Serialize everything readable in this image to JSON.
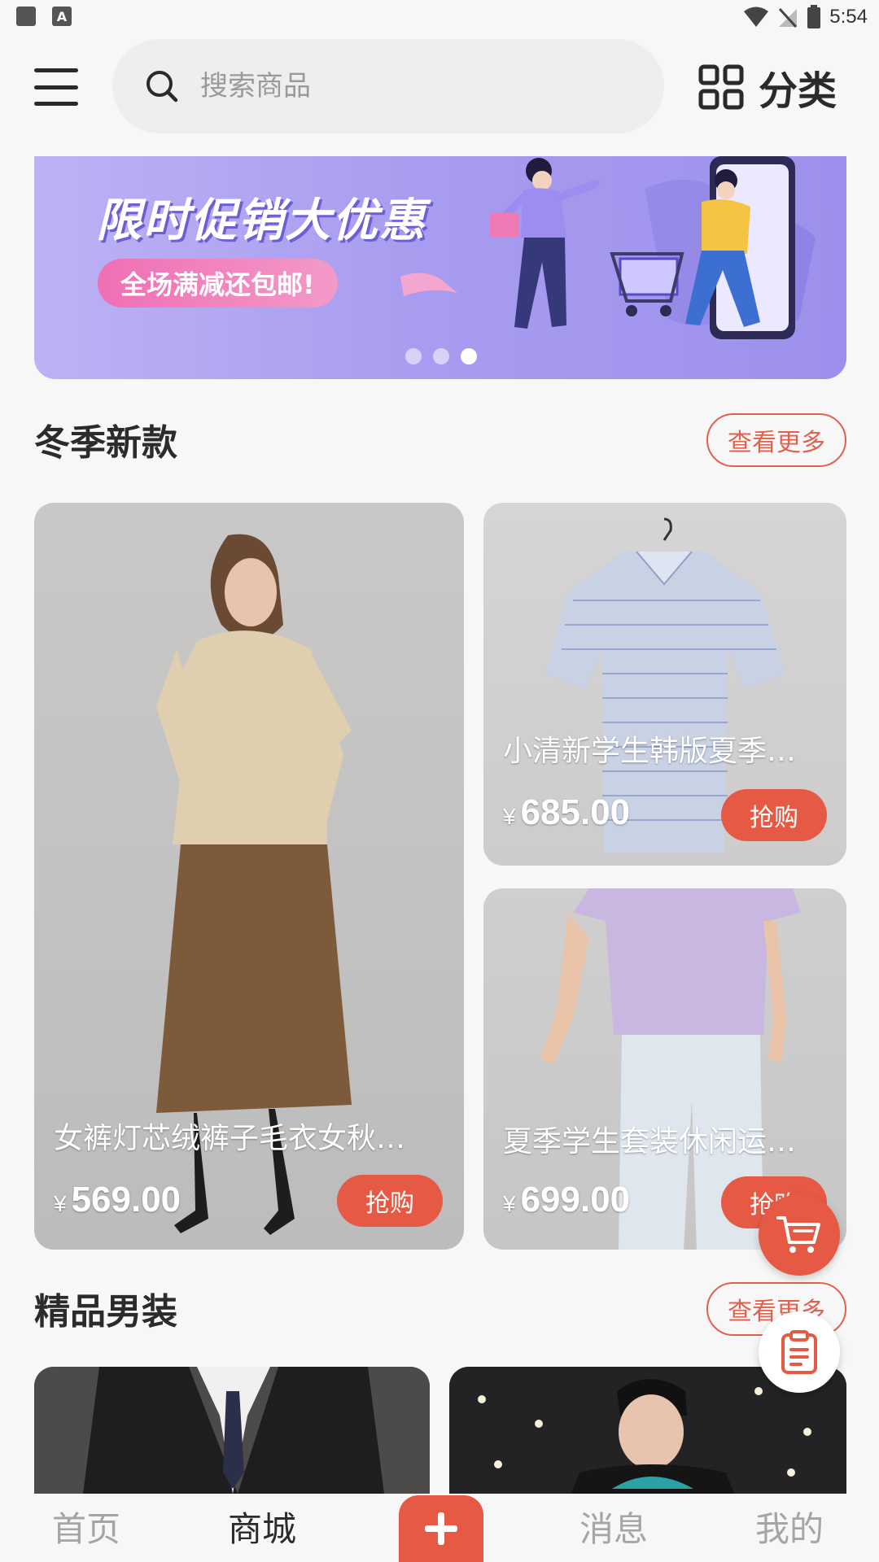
{
  "status_bar": {
    "time": "5:54",
    "left_icons": [
      "image-icon",
      "font-a-icon"
    ],
    "right_icons": [
      "wifi-icon",
      "no-signal-icon",
      "battery-icon"
    ]
  },
  "header": {
    "menu_icon": "menu-icon",
    "search_placeholder": "搜索商品",
    "category_label": "分类"
  },
  "banner": {
    "title": "限时促销大优惠",
    "subtitle": "全场满减还包邮!",
    "active_slide": 3,
    "slide_count": 3
  },
  "sections": [
    {
      "title": "冬季新款",
      "more_label": "查看更多",
      "products": [
        {
          "name": "女裤灯芯绒裤子毛衣女秋…",
          "currency": "¥",
          "price": "569.00",
          "buy_label": "抢购"
        },
        {
          "name": "小清新学生韩版夏季…",
          "currency": "¥",
          "price": "685.00",
          "buy_label": "抢购"
        },
        {
          "name": "夏季学生套装休闲运…",
          "currency": "¥",
          "price": "699.00",
          "buy_label": "抢购"
        }
      ]
    },
    {
      "title": "精品男装",
      "more_label": "查看更多"
    }
  ],
  "floating": {
    "cart_icon": "cart-icon",
    "orders_icon": "clipboard-icon"
  },
  "bottom_nav": {
    "items": [
      {
        "label": "首页",
        "active": false
      },
      {
        "label": "商城",
        "active": true
      },
      {
        "label": "消息",
        "active": false
      },
      {
        "label": "我的",
        "active": false
      }
    ],
    "plus_icon": "plus-icon"
  },
  "colors": {
    "accent": "#e65a45",
    "banner": "#a99df0",
    "background": "#f7f7f7"
  }
}
